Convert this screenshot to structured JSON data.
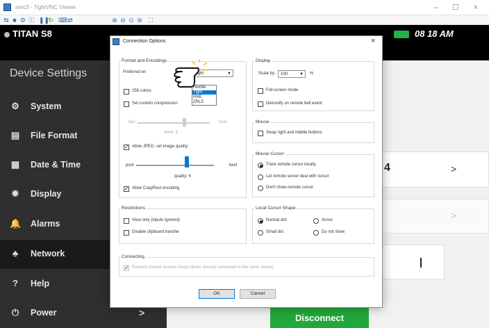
{
  "viewer": {
    "title": "amc3 - TightVNC Viewer",
    "minimize": "–",
    "maximize": "☐",
    "close": "×"
  },
  "device": {
    "model": "TITAN S8",
    "time": "08 18 AM",
    "page_title": "Device Settings",
    "sidebar_items": [
      {
        "label": "System",
        "icon": "gear-icon"
      },
      {
        "label": "File Format",
        "icon": "file-icon"
      },
      {
        "label": "Date & Time",
        "icon": "calendar-icon"
      },
      {
        "label": "Display",
        "icon": "sun-icon"
      },
      {
        "label": "Alarms",
        "icon": "alarm-icon"
      },
      {
        "label": "Network",
        "icon": "network-icon"
      },
      {
        "label": "Help",
        "icon": "help-icon"
      },
      {
        "label": "Power",
        "icon": "power-icon"
      }
    ],
    "content_value": "4",
    "chevron": ">",
    "disconnect_label": "Disconnect",
    "battery_color": "#22b14c",
    "accent_green": "#22a83a"
  },
  "dialog": {
    "title": "Connection Options",
    "format": {
      "title": "Format and Encodings",
      "preferred_label": "Preferred en",
      "preferred_value": "Tight",
      "encoding_options": [
        "Hextile",
        "Tight",
        "RRE",
        "ZRLE"
      ],
      "colors_256": "256 colors",
      "custom_compression": "Set custom compression",
      "fast": "fast",
      "best": "best",
      "level": "level: 6",
      "allow_jpeg": "Allow JPEG, set image quality:",
      "poor": "poor",
      "best2": "best",
      "quality": "quality: 6",
      "copyrect": "Allow CopyRect encoding"
    },
    "restrictions": {
      "title": "Restrictions",
      "view_only": "View only (inputs ignored)",
      "disable_clipboard": "Disable clipboard transfer"
    },
    "display": {
      "title": "Display",
      "scale_label": "Scale by:",
      "scale_value": "100",
      "percent": "%",
      "fullscreen": "Full-screen mode",
      "deiconify": "Deiconify on remote bell event"
    },
    "mouse": {
      "title": "Mouse",
      "swap": "Swap right and middle buttons"
    },
    "mouse_cursor": {
      "title": "Mouse Cursor",
      "track": "Track remote cursor locally",
      "let_server": "Let remote server deal with cursor",
      "dont_show": "Don't show remote cursor"
    },
    "local_cursor": {
      "title": "Local Cursor Shape",
      "normal_dot": "Normal dot",
      "arrow": "Arrow",
      "small_dot": "Small dot",
      "do_not_show": "Do not show"
    },
    "connecting": {
      "title": "Connecting",
      "shared": "Request shared session (keep clients already connected to the same server)"
    },
    "ok": "OK",
    "cancel": "Cancel",
    "close": "×"
  }
}
